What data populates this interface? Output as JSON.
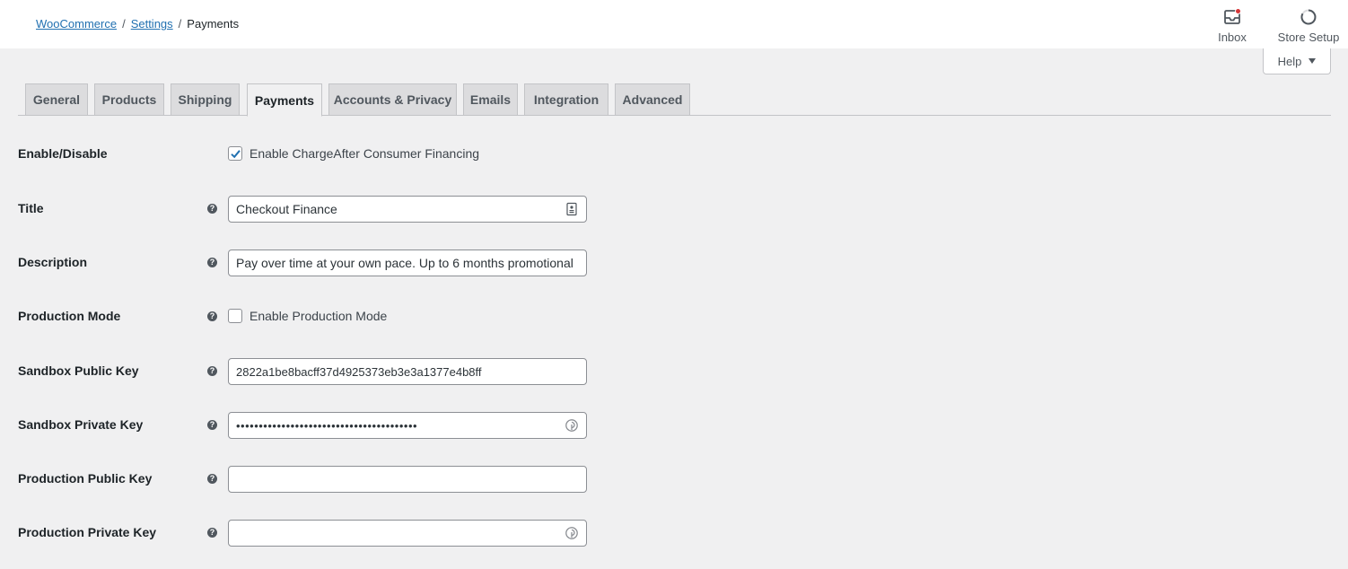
{
  "breadcrumb": {
    "woocommerce": "WooCommerce",
    "settings": "Settings",
    "separator": "/",
    "current": "Payments"
  },
  "top_actions": {
    "inbox": "Inbox",
    "store_setup": "Store Setup",
    "inbox_icon": "inbox-icon",
    "store_setup_icon": "progress-ring-icon",
    "notification_color": "#d63638"
  },
  "help": {
    "label": "Help"
  },
  "tabs": [
    "General",
    "Products",
    "Shipping",
    "Payments",
    "Accounts & Privacy",
    "Emails",
    "Integration",
    "Advanced"
  ],
  "active_tab": "Payments",
  "form": {
    "enable": {
      "label": "Enable/Disable",
      "checkbox_label": "Enable ChargeAfter Consumer Financing",
      "checked": true
    },
    "title": {
      "label": "Title",
      "value": "Checkout Finance"
    },
    "description": {
      "label": "Description",
      "value": "Pay over time at your own pace. Up to 6 months promotional"
    },
    "production_mode": {
      "label": "Production Mode",
      "checkbox_label": "Enable Production Mode",
      "checked": false
    },
    "sandbox_public_key": {
      "label": "Sandbox Public Key",
      "value": "2822a1be8bacff37d4925373eb3e3a1377e4b8ff"
    },
    "sandbox_private_key": {
      "label": "Sandbox Private Key",
      "value": "••••••••••••••••••••••••••••••••••••••••"
    },
    "production_public_key": {
      "label": "Production Public Key",
      "value": ""
    },
    "production_private_key": {
      "label": "Production Private Key",
      "value": ""
    }
  },
  "help_tip_glyph": "?",
  "colors": {
    "accent": "#2271b1",
    "check": "#2271b1"
  }
}
